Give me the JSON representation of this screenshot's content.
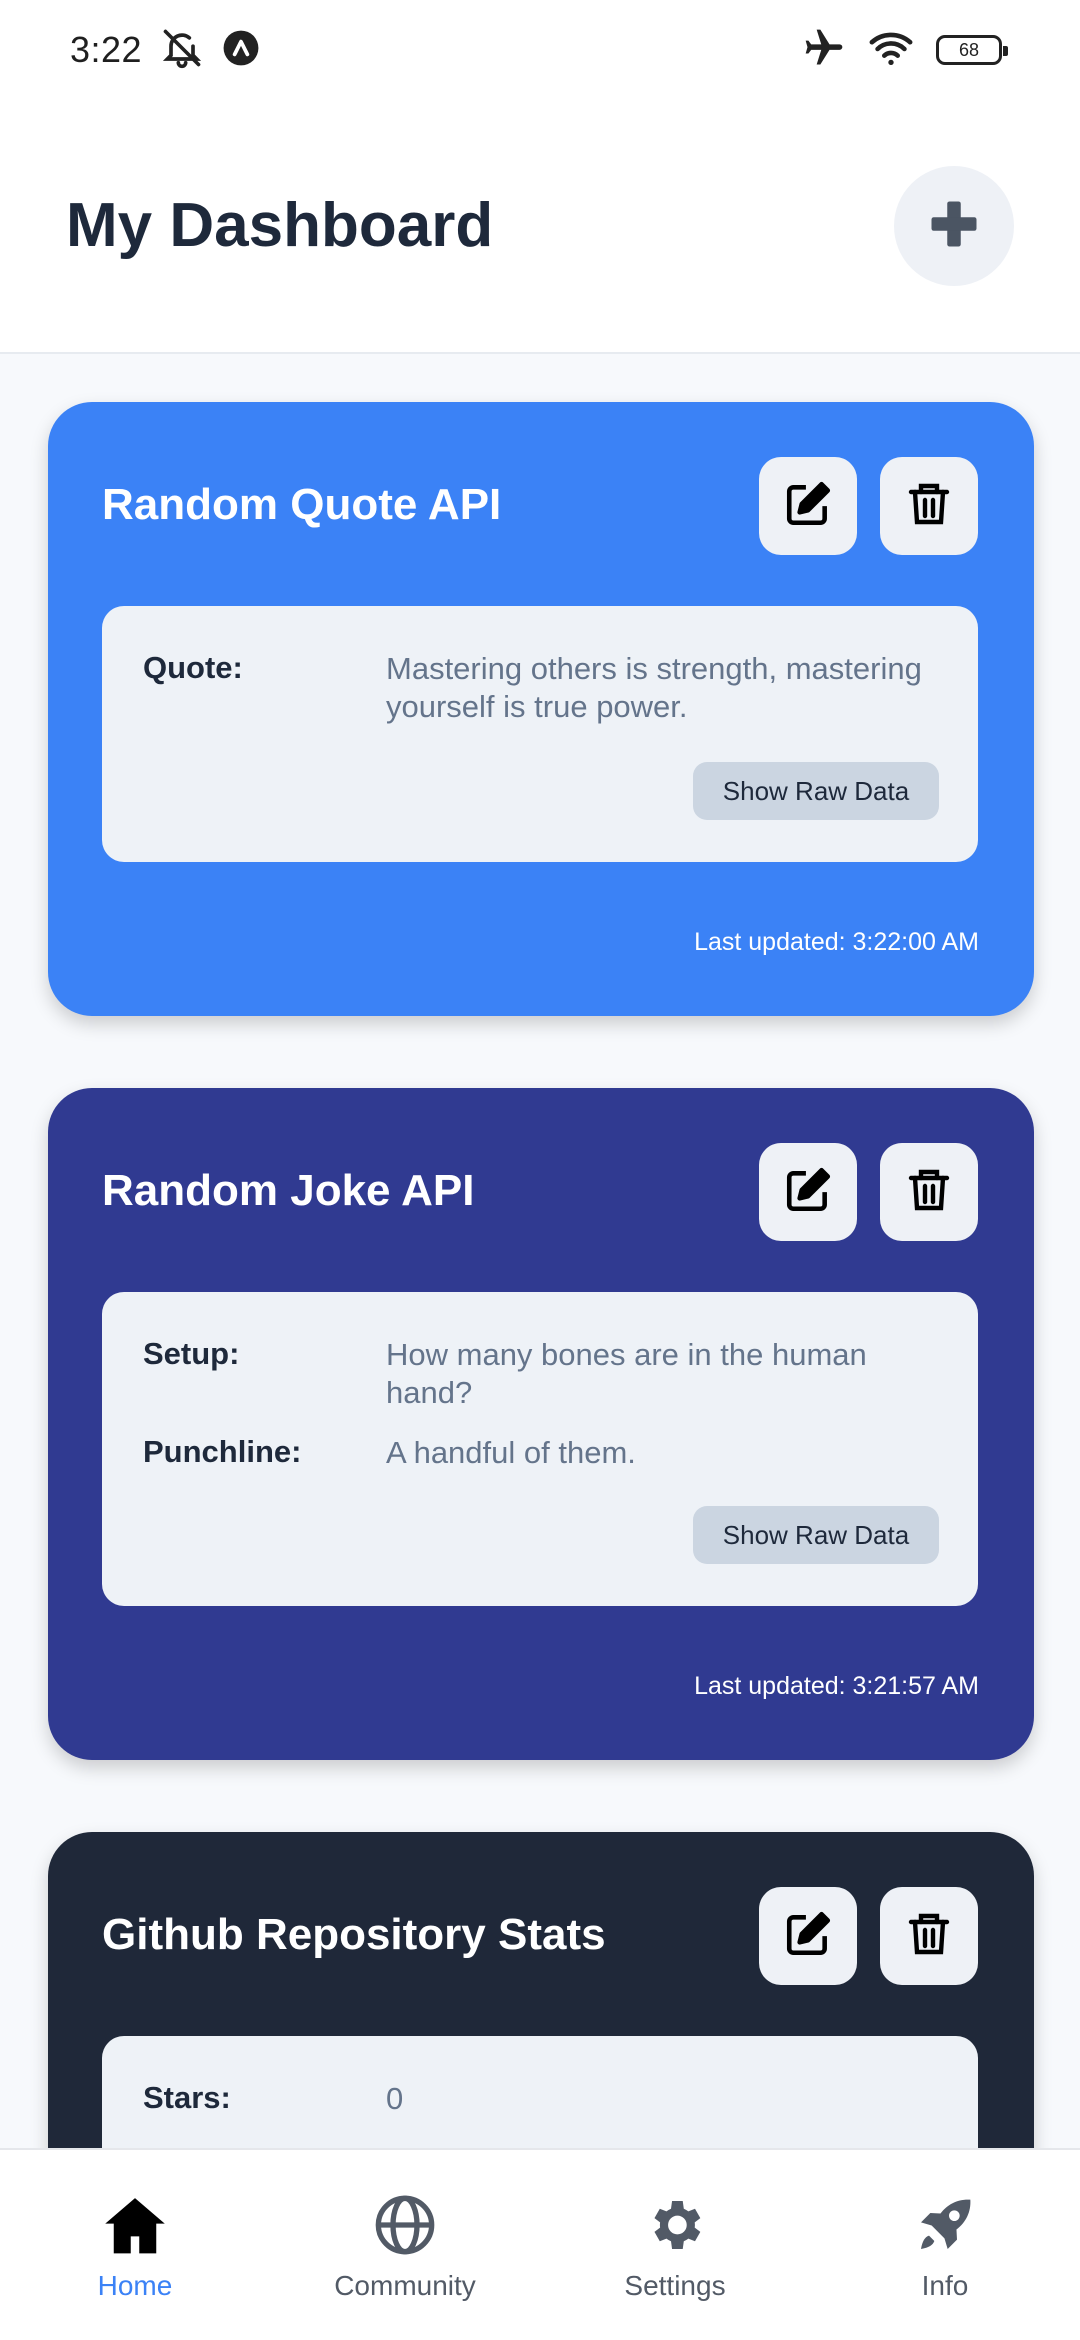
{
  "status_bar": {
    "time": "3:22",
    "battery": "68",
    "icons": [
      "bell-off-icon",
      "notification-app-icon",
      "airplane-icon",
      "wifi-icon",
      "battery-icon"
    ]
  },
  "header": {
    "title": "My Dashboard",
    "add_icon": "plus-icon"
  },
  "cards": [
    {
      "title": "Random Quote API",
      "color": "#3b82f6",
      "fields": [
        {
          "label": "Quote:",
          "value": "Mastering others is strength, mastering yourself is true power."
        }
      ],
      "raw_button": "Show Raw Data",
      "last_updated": "Last updated: 3:22:00 AM"
    },
    {
      "title": "Random Joke API",
      "color": "#303a91",
      "fields": [
        {
          "label": "Setup:",
          "value": "How many bones are in the human hand?"
        },
        {
          "label": "Punchline:",
          "value": "A handful of them."
        }
      ],
      "raw_button": "Show Raw Data",
      "last_updated": "Last updated: 3:21:57 AM"
    },
    {
      "title": "Github Repository Stats",
      "color": "#1f2839",
      "fields": [
        {
          "label": "Stars:",
          "value": "0"
        }
      ]
    }
  ],
  "nav": {
    "items": [
      {
        "label": "Home",
        "icon": "home-icon",
        "active": true
      },
      {
        "label": "Community",
        "icon": "globe-icon",
        "active": false
      },
      {
        "label": "Settings",
        "icon": "gear-icon",
        "active": false
      },
      {
        "label": "Info",
        "icon": "rocket-icon",
        "active": false
      }
    ],
    "active_color": "#3b82f6"
  }
}
